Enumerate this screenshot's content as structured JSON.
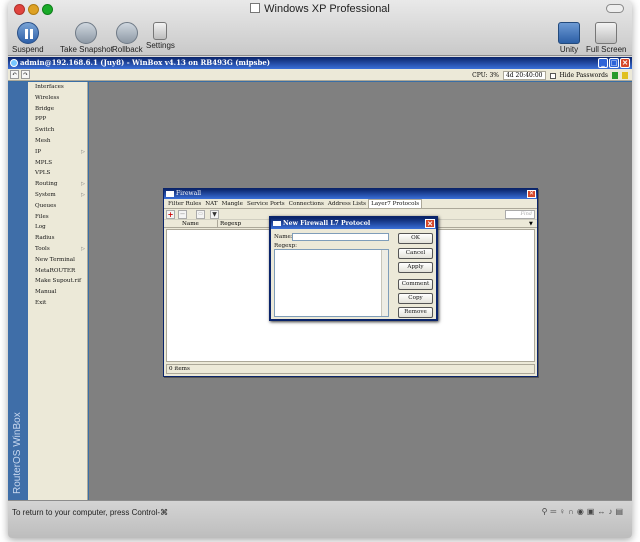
{
  "mac": {
    "window_title": "Windows XP Professional",
    "toolbar": [
      {
        "label": "Suspend"
      },
      {
        "label": "Take Snapshot"
      },
      {
        "label": "Rollback"
      },
      {
        "label": "Settings"
      }
    ],
    "toolbar_right": [
      {
        "label": "Unity"
      },
      {
        "label": "Full Screen"
      }
    ],
    "bottom_message": "To return to your computer, press Control-⌘"
  },
  "winbox": {
    "title": "admin@192.168.6.1 (Juy8) - WinBox v4.13 on RB493G (mipsbe)",
    "cpu": "CPU: 3%",
    "time": "4d 20:40:00",
    "hide_passwords": "Hide Passwords",
    "brand": "RouterOS WinBox",
    "menu": [
      {
        "label": "Interfaces",
        "arrow": false
      },
      {
        "label": "Wireless",
        "arrow": false
      },
      {
        "label": "Bridge",
        "arrow": false
      },
      {
        "label": "PPP",
        "arrow": false
      },
      {
        "label": "Switch",
        "arrow": false
      },
      {
        "label": "Mesh",
        "arrow": false
      },
      {
        "label": "IP",
        "arrow": true
      },
      {
        "label": "MPLS",
        "arrow": false
      },
      {
        "label": "VPLS",
        "arrow": false
      },
      {
        "label": "Routing",
        "arrow": true
      },
      {
        "label": "System",
        "arrow": true
      },
      {
        "label": "Queues",
        "arrow": false
      },
      {
        "label": "Files",
        "arrow": false
      },
      {
        "label": "Log",
        "arrow": false
      },
      {
        "label": "Radius",
        "arrow": false
      },
      {
        "label": "Tools",
        "arrow": true
      },
      {
        "label": "New Terminal",
        "arrow": false
      },
      {
        "label": "MetaROUTER",
        "arrow": false
      },
      {
        "label": "Make Supout.rif",
        "arrow": false
      },
      {
        "label": "Manual",
        "arrow": false
      },
      {
        "label": "Exit",
        "arrow": false
      }
    ]
  },
  "firewall": {
    "title": "Firewall",
    "tabs": [
      {
        "label": "Filter Rules",
        "active": false
      },
      {
        "label": "NAT",
        "active": false
      },
      {
        "label": "Mangle",
        "active": false
      },
      {
        "label": "Service Ports",
        "active": false
      },
      {
        "label": "Connections",
        "active": false
      },
      {
        "label": "Address Lists",
        "active": false
      },
      {
        "label": "Layer7 Protocols",
        "active": true
      }
    ],
    "find_placeholder": "Find",
    "columns": [
      "Name",
      "Regexp"
    ],
    "status": "0 items"
  },
  "dialog": {
    "title": "New Firewall L7 Protocol",
    "name_label": "Name:",
    "regexp_label": "Regexp:",
    "name_value": "",
    "buttons": {
      "ok": "OK",
      "cancel": "Cancel",
      "apply": "Apply",
      "comment": "Comment",
      "copy": "Copy",
      "remove": "Remove"
    }
  }
}
